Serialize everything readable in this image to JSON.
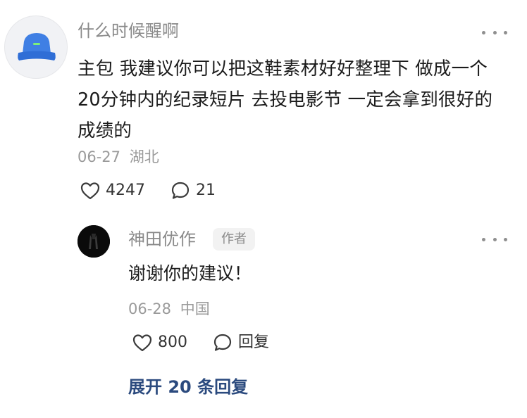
{
  "comment": {
    "username": "什么时候醒啊",
    "avatar_icon": "bucket-hat-icon",
    "text": "主包 我建议你可以把这鞋素材好好整理下 做成一个20分钟内的纪录短片 去投电影节 一定会拿到很好的成绩的",
    "date": "06-27",
    "location": "湖北",
    "likes": "4247",
    "replies": "21"
  },
  "reply": {
    "username": "神田优作",
    "badge": "作者",
    "text": "谢谢你的建议！",
    "date": "06-28",
    "location": "中国",
    "likes": "800",
    "reply_label": "回复"
  },
  "expand_label": "展开 20 条回复",
  "colors": {
    "link": "#2b4a7e",
    "meta": "#9a9a9a",
    "hat": "#3e7de0"
  }
}
